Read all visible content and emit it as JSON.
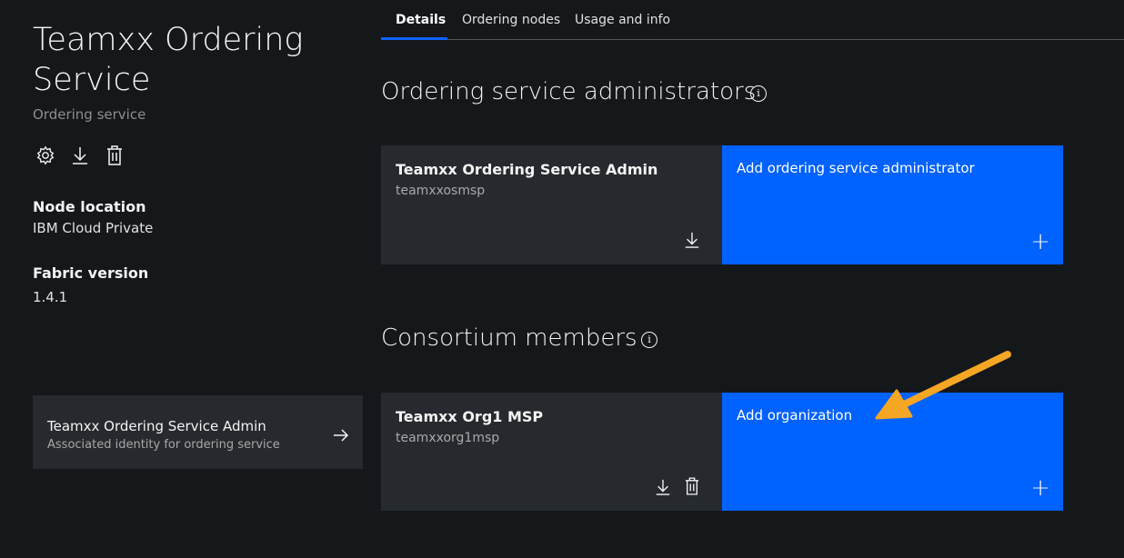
{
  "sidebar": {
    "title": "Teamxx Ordering Service",
    "subtitle": "Ordering service",
    "node_location_label": "Node location",
    "node_location_value": "IBM Cloud Private",
    "fabric_version_label": "Fabric version",
    "fabric_version_value": "1.4.1",
    "identity": {
      "name": "Teamxx Ordering Service Admin",
      "description": "Associated identity for ordering service"
    }
  },
  "tabs": [
    {
      "label": "Details"
    },
    {
      "label": "Ordering nodes"
    },
    {
      "label": "Usage and info"
    }
  ],
  "admins": {
    "heading": "Ordering service administrators",
    "card": {
      "name": "Teamxx Ordering Service Admin",
      "msp": "teamxxosmsp"
    },
    "add_label": "Add ordering service administrator"
  },
  "members": {
    "heading": "Consortium members",
    "card": {
      "name": "Teamxx Org1 MSP",
      "msp": "teamxxorg1msp"
    },
    "add_label": "Add organization"
  },
  "colors": {
    "accent": "#0062ff",
    "annotation_arrow": "#f5a623"
  }
}
